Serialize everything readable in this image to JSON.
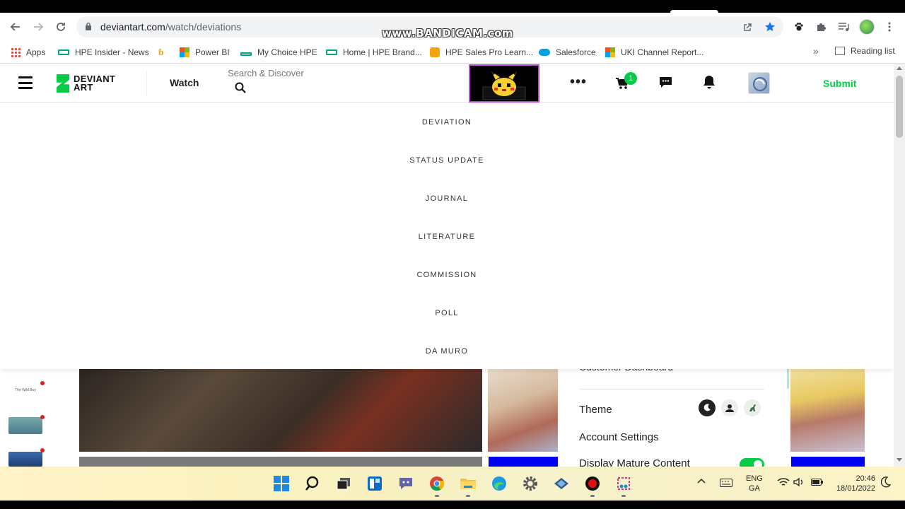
{
  "browser": {
    "url_host": "deviantart.com",
    "url_path": "/watch/deviations",
    "watermark": "www.BANDICAM.com",
    "reading_list": "Reading list",
    "more_bookmarks": "»"
  },
  "bookmarks": [
    {
      "label": "Apps",
      "icon": "apps-grid-icon"
    },
    {
      "label": "HPE Insider - News",
      "icon": "hpe-icon"
    },
    {
      "label": "",
      "icon": "bookmark-b-icon"
    },
    {
      "label": "Power BI",
      "icon": "microsoft-icon"
    },
    {
      "label": "My Choice HPE",
      "icon": "hpe-icon"
    },
    {
      "label": "Home | HPE Brand...",
      "icon": "hpe-icon"
    },
    {
      "label": "HPE Sales Pro Learn...",
      "icon": "orange-icon"
    },
    {
      "label": "Salesforce",
      "icon": "salesforce-icon"
    },
    {
      "label": "UKI Channel Report...",
      "icon": "microsoft-icon"
    }
  ],
  "header": {
    "logo_line1": "DEVIANT",
    "logo_line2": "ART",
    "watch": "Watch",
    "search_placeholder": "Search & Discover",
    "more": "•••",
    "cart_count": "1",
    "submit": "Submit"
  },
  "dropdown": {
    "items": [
      "DEVIATION",
      "STATUS UPDATE",
      "JOURNAL",
      "LITERATURE",
      "COMMISSION",
      "POLL",
      "DA MURO"
    ]
  },
  "user_panel": {
    "partial_item": "Customer Dashboard",
    "theme": "Theme",
    "account_settings": "Account Settings",
    "display_mature": "Display Mature Content"
  },
  "sidebar": {
    "thumb1_text": "The Wild Boy"
  },
  "taskbar": {
    "lang_line1": "ENG",
    "lang_line2": "GA",
    "time": "20:46",
    "date": "18/01/2022"
  },
  "colors": {
    "brand_green": "#05cc47",
    "banner_border": "#b84bd1",
    "blue_tile": "#0000f0"
  }
}
